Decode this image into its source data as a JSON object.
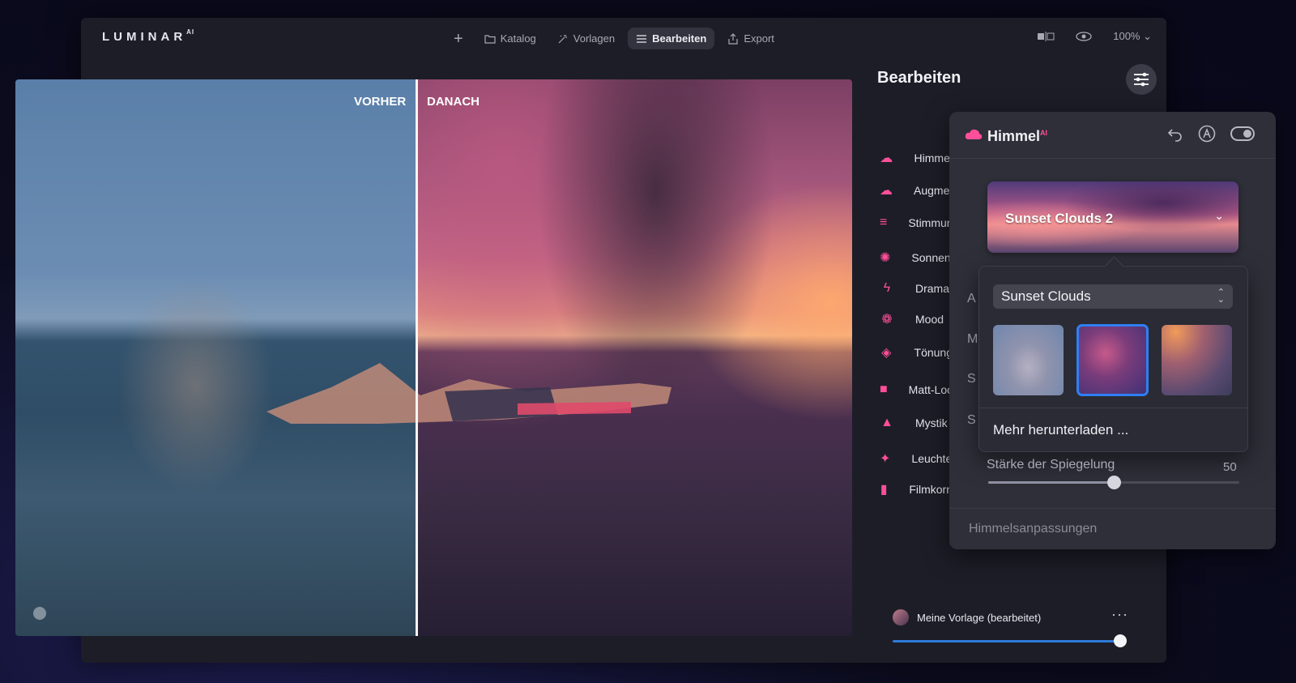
{
  "app": {
    "logo": "LUMINAR",
    "logo_sup": "AI"
  },
  "topnav": {
    "add_label": "+",
    "katalog": "Katalog",
    "vorlagen": "Vorlagen",
    "bearbeiten": "Bearbeiten",
    "export": "Export",
    "zoom": "100% ⌄"
  },
  "photo": {
    "before_label": "VORHER",
    "after_label": "DANACH"
  },
  "panel": {
    "title": "Bearbeiten"
  },
  "tools": [
    {
      "label": "Himmel",
      "icon": "cloud-icon"
    },
    {
      "label": "Augmented",
      "icon": "cloud-outline-icon"
    },
    {
      "label": "Stimmung",
      "icon": "lines-icon"
    },
    {
      "label": "Sonnenstrahlen",
      "icon": "sun-icon"
    },
    {
      "label": "Drama",
      "icon": "lightning-icon"
    },
    {
      "label": "Mood",
      "icon": "mood-icon"
    },
    {
      "label": "Tönung",
      "icon": "paint-bucket-icon"
    },
    {
      "label": "Matt-Look",
      "icon": "square-icon"
    },
    {
      "label": "Mystik",
      "icon": "mountain-icon"
    },
    {
      "label": "Leuchten",
      "icon": "sparkle-icon"
    },
    {
      "label": "Filmkorn",
      "icon": "film-icon"
    }
  ],
  "preset": {
    "name": "Meine Vorlage (bearbeitet)",
    "more": "···",
    "amount": 100
  },
  "himmel": {
    "title": "Himmel",
    "title_sup": "AI",
    "selected_sky": "Sunset Clouds 2",
    "rows": [
      "A",
      "M",
      "S",
      "S"
    ],
    "dropdown": {
      "category": "Sunset Clouds",
      "thumbs": [
        "sky-thumb-1",
        "sky-thumb-2",
        "sky-thumb-3"
      ],
      "selected_index": 1,
      "more": "Mehr herunterladen ..."
    },
    "reflection_label": "Stärke der Spiegelung",
    "reflection_value": "50",
    "adjust_label": "Himmelsanpassungen"
  },
  "colors": {
    "accent": "#ff4f9a",
    "select_blue": "#2f7ff4"
  }
}
